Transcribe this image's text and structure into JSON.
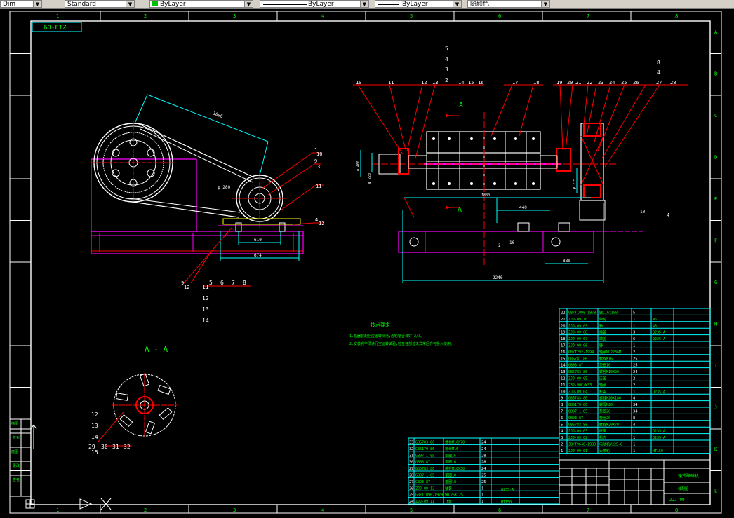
{
  "toolbar": {
    "dimstyle_value": "Dim",
    "textstyle_value": "Standard",
    "color_value": "ByLayer",
    "color_swatch": "#00c000",
    "linetype_value": "ByLayer",
    "lineweight_value": "ByLayer",
    "plotstyle_value": "随颜色"
  },
  "drawing": {
    "border_numbers": [
      "1",
      "2",
      "3",
      "4",
      "5",
      "6",
      "7",
      "8"
    ],
    "border_letters": [
      "A",
      "B",
      "C",
      "D",
      "E",
      "F",
      "G",
      "H",
      "I",
      "J",
      "K",
      "L"
    ],
    "title_stamp": "60-FTZ",
    "section_label": "A - A",
    "view_label_a": "A",
    "view_label_a2": "A",
    "dim_belt": "1086",
    "dim_d": "φ 280",
    "dim_w1": "610",
    "dim_w2": "674",
    "dim_l1": "1880",
    "dim_l2": "2240",
    "dim_l3": "440",
    "dim_l4": "880",
    "dim_h1": "φ 400",
    "dim_h2": "φ 220",
    "dim_h3": "φ 275",
    "tech_title": "技术要求",
    "tech_line1": "1.机器装配后应运转灵活,齿轮啮合良好 2/3。",
    "tech_line2": "2.安装完毕须进行空运转试验,检查各部位无异常后方可投入使用。",
    "left_callouts": [
      "1",
      "10",
      "9",
      "3",
      "11",
      "4",
      "12",
      "9",
      "12"
    ],
    "bottom_left_nums": [
      "5",
      "6",
      "7",
      "8"
    ],
    "stack_left": [
      "11",
      "12",
      "13",
      "14"
    ],
    "right_top_nums": [
      "10",
      "11",
      "12",
      "13",
      "14",
      "15",
      "16",
      "17",
      "18",
      "19",
      "20",
      "21",
      "22",
      "23",
      "24",
      "25",
      "26",
      "27",
      "28"
    ],
    "stack_mid": [
      "5",
      "4",
      "3",
      "2"
    ],
    "stack_right": [
      "8",
      "4"
    ],
    "misc_labels": [
      "2",
      "10",
      "10",
      "4"
    ],
    "aa_callouts": [
      "12",
      "13",
      "14",
      "15",
      "29",
      "30",
      "31",
      "32"
    ]
  },
  "bom_right": [
    [
      "22",
      "GB/T1096-1979",
      "键C16X100",
      "5",
      "",
      ""
    ],
    [
      "21",
      "ZJJ-09-10",
      "带轮",
      "1",
      "45",
      ""
    ],
    [
      "20",
      "ZJJ-09-09",
      "轴",
      "1",
      "45",
      ""
    ],
    [
      "19",
      "ZJJ-09-08",
      "端盖",
      "3",
      "Q235-A",
      ""
    ],
    [
      "18",
      "ZJJ-09-07",
      "端盖",
      "6",
      "Q235-A",
      ""
    ],
    [
      "17",
      "ZJJ-09-06",
      "锤",
      "1",
      "",
      ""
    ],
    [
      "16",
      "GB/T292-1994",
      "轴承NU2236M",
      "2",
      "",
      ""
    ],
    [
      "15",
      "GB5781-86",
      "螺栓M16",
      "25",
      "",
      ""
    ],
    [
      "14",
      "GB93-87",
      "垫圈16",
      "25",
      "",
      ""
    ],
    [
      "13",
      "GB5783-86",
      "螺栓M10X20",
      "24",
      "",
      ""
    ],
    [
      "12",
      "ZJJ-09-05",
      "压盖",
      "2",
      "",
      ""
    ],
    [
      "11",
      "232-90C/W33",
      "轴承",
      "2",
      "",
      ""
    ],
    [
      "10",
      "ZJJ-09-04",
      "机架",
      "1",
      "Q235-A",
      ""
    ],
    [
      "9",
      "GB5783-86",
      "螺栓M20X180",
      "4",
      "",
      ""
    ],
    [
      "8",
      "GB6170-86",
      "螺母M20",
      "34",
      "",
      ""
    ],
    [
      "7",
      "GB97.1-85",
      "垫圈20",
      "34",
      "",
      ""
    ],
    [
      "6",
      "GB93-87",
      "垫圈20",
      "8",
      "",
      ""
    ],
    [
      "5",
      "GB5783-86",
      "螺栓M20X70",
      "4",
      "",
      ""
    ],
    [
      "4",
      "ZJJ-09-03",
      "底座",
      "1",
      "Q235-A",
      ""
    ],
    [
      "3",
      "ZJJ-09-02",
      "机壳",
      "1",
      "Q235-A",
      ""
    ],
    [
      "2",
      "JB/T9646-1999",
      "电动机Y225-6",
      "1",
      "",
      ""
    ],
    [
      "1",
      "ZJJ-09-01",
      "大带轮",
      "1",
      "HT150",
      ""
    ]
  ],
  "bom_left": [
    [
      "33",
      "GB5783-86",
      "螺栓M16X70",
      "24"
    ],
    [
      "32",
      "GB6170-86",
      "螺母M16",
      "24"
    ],
    [
      "31",
      "GB97.1-85",
      "垫圈16",
      "28"
    ],
    [
      "30",
      "GB93-87",
      "垫圈16",
      "28"
    ],
    [
      "29",
      "GB5783-86",
      "螺栓M10X30",
      "24"
    ],
    [
      "28",
      "GB97.1-85",
      "垫圈10",
      "25"
    ],
    [
      "27",
      "GB93-87",
      "垫圈10",
      "25"
    ],
    [
      "26",
      "ZJJ-09-12",
      "轴套",
      "1"
    ],
    [
      "25",
      "GB/T1096-1979",
      "键C25X125",
      "1"
    ],
    [
      "24",
      "ZJJ-09-11",
      "飞轮",
      "1"
    ]
  ],
  "bom_left_material": [
    "Q235-A",
    "HT150"
  ],
  "title_block": {
    "name": "锤式破碎机",
    "subtitle": "装配图",
    "code": "ZJJ-09"
  },
  "side_panel": {
    "labels": [
      "描图",
      "校对",
      "底图",
      "更改",
      "签名"
    ]
  },
  "colors": {
    "frame": "#ffffff",
    "red": "#ff0000",
    "cyan": "#00ffff",
    "magenta": "#ff00ff",
    "yellow": "#ffff00",
    "green": "#00ff00",
    "white": "#ffffff"
  }
}
